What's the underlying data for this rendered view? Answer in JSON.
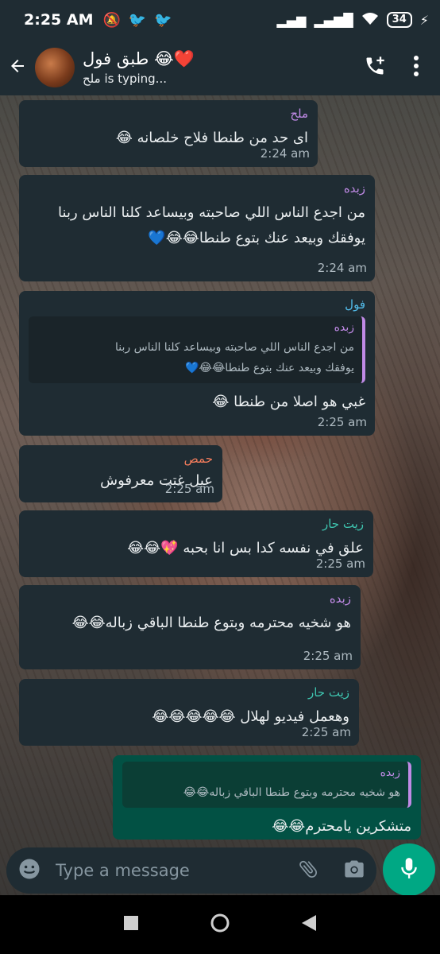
{
  "status_bar": {
    "time": "2:25 AM",
    "battery": "34"
  },
  "header": {
    "title": "طبق فول 😂❤️",
    "subtitle": "ملح is typing..."
  },
  "messages": [
    {
      "sender": "ملح",
      "sender_color": "#c08ae6",
      "text": "اى حد من طنطا فلاح خلصانه 😂",
      "time": "2:24 am"
    },
    {
      "sender": "زبده",
      "sender_color": "#c08ae6",
      "text_line1": "من اجدع الناس اللي صاحبته وبيساعد كلنا الناس ربنا",
      "text_line2": "يوفقك وبيعد عنك بتوع طنطا😂😂💙",
      "time": "2:24 am"
    },
    {
      "sender": "فول",
      "sender_color": "#53bdeb",
      "quote": {
        "name": "زبده",
        "line1": "من اجدع الناس اللي صاحبته وبيساعد كلنا الناس ربنا",
        "line2": "يوفقك وبيعد عنك بتوع طنطا😂😂💙"
      },
      "text": "غبي هو اصلا من طنطا 😂",
      "time": "2:25 am"
    },
    {
      "sender": "حمص",
      "sender_color": "#f27c5c",
      "text": "عيل غتت معرفوش",
      "time": "2:25 am"
    },
    {
      "sender": "زيت حار",
      "sender_color": "#3ec5b0",
      "text": "علق في نفسه كدا بس انا بحبه 💖😂😂",
      "time": "2:25 am"
    },
    {
      "sender": "زبده",
      "sender_color": "#c08ae6",
      "text": "هو شخيه محترمه وبتوع طنطا الباقي زباله😂😂",
      "time": "2:25 am"
    },
    {
      "sender": "زيت حار",
      "sender_color": "#3ec5b0",
      "text": "وهعمل فيديو لهلال 😂😂😂😂😂",
      "time": "2:25 am"
    },
    {
      "outgoing": true,
      "quote": {
        "name": "زبده",
        "line1": "هو شخيه محترمه وبتوع طنطا الباقي زباله😂😂"
      },
      "text": "متشكرين يامحترم😂😂"
    }
  ],
  "composer": {
    "placeholder": "Type a message"
  },
  "icons": {
    "back": "arrow-left-icon",
    "add_call": "add-call-icon",
    "menu": "more-vert-icon",
    "emoji": "emoji-icon",
    "attach": "paperclip-icon",
    "camera": "camera-icon",
    "mic": "mic-icon"
  },
  "colors": {
    "bar": "#1f2c33",
    "incoming": "#1f2c33",
    "outgoing": "#025144",
    "accent": "#00a884"
  }
}
